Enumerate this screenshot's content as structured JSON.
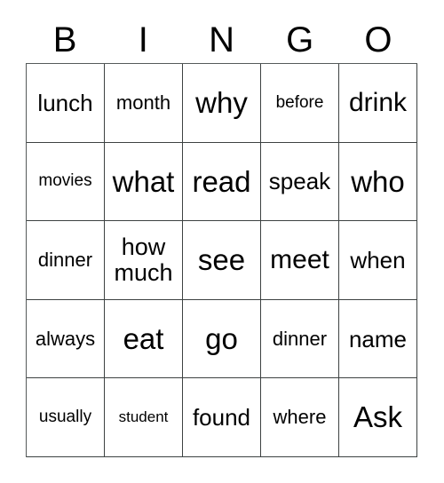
{
  "card": {
    "header_letters": [
      "B",
      "I",
      "N",
      "G",
      "O"
    ],
    "columns": 5,
    "rows": 5,
    "grid_border_color": "#3d4242",
    "background_color": "#ffffff",
    "text_color": "#000000",
    "cells": [
      [
        {
          "text": "lunch",
          "size": "sz-md"
        },
        {
          "text": "month",
          "size": "sz-sm"
        },
        {
          "text": "why",
          "size": "sz-xl"
        },
        {
          "text": "before",
          "size": "sz-xs"
        },
        {
          "text": "drink",
          "size": "sz-lg"
        }
      ],
      [
        {
          "text": "movies",
          "size": "sz-xs"
        },
        {
          "text": "what",
          "size": "sz-xl"
        },
        {
          "text": "read",
          "size": "sz-xl"
        },
        {
          "text": "speak",
          "size": "sz-md"
        },
        {
          "text": "who",
          "size": "sz-xl"
        }
      ],
      [
        {
          "text": "dinner",
          "size": "sz-sm"
        },
        {
          "text": "how\nmuch",
          "size": "sz-two"
        },
        {
          "text": "see",
          "size": "sz-xl"
        },
        {
          "text": "meet",
          "size": "sz-lg"
        },
        {
          "text": "when",
          "size": "sz-md"
        }
      ],
      [
        {
          "text": "always",
          "size": "sz-sm"
        },
        {
          "text": "eat",
          "size": "sz-xl"
        },
        {
          "text": "go",
          "size": "sz-xl"
        },
        {
          "text": "dinner",
          "size": "sz-sm"
        },
        {
          "text": "name",
          "size": "sz-md"
        }
      ],
      [
        {
          "text": "usually",
          "size": "sz-xs"
        },
        {
          "text": "student",
          "size": "sz-xxs"
        },
        {
          "text": "found",
          "size": "sz-md"
        },
        {
          "text": "where",
          "size": "sz-sm"
        },
        {
          "text": "Ask",
          "size": "sz-xl"
        }
      ]
    ]
  }
}
